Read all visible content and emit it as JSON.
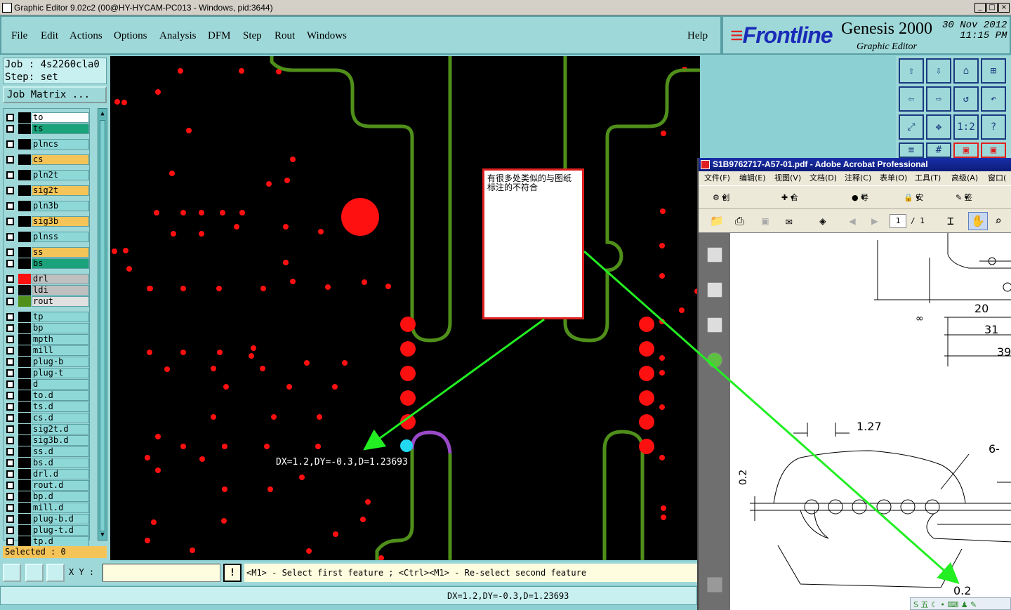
{
  "window": {
    "title": "Graphic Editor 9.02c2 (00@HY-HYCAM-PC013 - Windows, pid:3644)",
    "buttons": [
      "_",
      "□",
      "×"
    ]
  },
  "menu": {
    "items": [
      "File",
      "Edit",
      "Actions",
      "Options",
      "Analysis",
      "DFM",
      "Step",
      "Rout",
      "Windows"
    ],
    "help": "Help"
  },
  "brand": {
    "logo": "Frontline",
    "product": "Genesis 2000",
    "subtitle": "Graphic Editor",
    "date": "30 Nov 2012",
    "time": "11:15 PM"
  },
  "job": {
    "job_line": "Job : 4s2260cla0",
    "step_line": "Step: set",
    "matrix_button": "Job Matrix ..."
  },
  "layers": [
    {
      "name": "to",
      "color": "#ffffff"
    },
    {
      "name": "ts",
      "color": "#1aa37a"
    },
    {
      "name": "plncs",
      "color": "#8fd8d8"
    },
    {
      "name": "cs",
      "color": "#f5c458"
    },
    {
      "name": "pln2t",
      "color": "#8fd8d8"
    },
    {
      "name": "sig2t",
      "color": "#f5c458"
    },
    {
      "name": "pln3b",
      "color": "#8fd8d8"
    },
    {
      "name": "sig3b",
      "color": "#f5c458"
    },
    {
      "name": "plnss",
      "color": "#8fd8d8"
    },
    {
      "name": "ss",
      "color": "#f5c458"
    },
    {
      "name": "bs",
      "color": "#1aa37a"
    },
    {
      "name": "drl",
      "color": "#c0c0c0"
    },
    {
      "name": "ldi",
      "color": "#c0c0c0"
    },
    {
      "name": "rout",
      "color": "#e0e0e0"
    },
    {
      "name": "tp",
      "color": "#8fd8d8"
    },
    {
      "name": "bp",
      "color": "#8fd8d8"
    },
    {
      "name": "mpth",
      "color": "#8fd8d8"
    },
    {
      "name": "mill",
      "color": "#8fd8d8"
    },
    {
      "name": "plug-b",
      "color": "#8fd8d8"
    },
    {
      "name": "plug-t",
      "color": "#8fd8d8"
    },
    {
      "name": "d",
      "color": "#8fd8d8"
    },
    {
      "name": "to.d",
      "color": "#8fd8d8"
    },
    {
      "name": "ts.d",
      "color": "#8fd8d8"
    },
    {
      "name": "cs.d",
      "color": "#8fd8d8"
    },
    {
      "name": "sig2t.d",
      "color": "#8fd8d8"
    },
    {
      "name": "sig3b.d",
      "color": "#8fd8d8"
    },
    {
      "name": "ss.d",
      "color": "#8fd8d8"
    },
    {
      "name": "bs.d",
      "color": "#8fd8d8"
    },
    {
      "name": "drl.d",
      "color": "#8fd8d8"
    },
    {
      "name": "rout.d",
      "color": "#8fd8d8"
    },
    {
      "name": "bp.d",
      "color": "#8fd8d8"
    },
    {
      "name": "mill.d",
      "color": "#8fd8d8"
    },
    {
      "name": "plug-b.d",
      "color": "#8fd8d8"
    },
    {
      "name": "plug-t.d",
      "color": "#8fd8d8"
    },
    {
      "name": "tp.d",
      "color": "#8fd8d8"
    }
  ],
  "selected": "Selected : 0",
  "xy_label": "X Y :",
  "prompt": "<M1> - Select first feature ; <Ctrl><M1> - Re-select second feature",
  "status": "DX=1.2,DY=-0.3,D=1.23693",
  "measure_label": "DX=1.2,DY=-0.3,D=1.23693",
  "note": "有很多处类似的与图纸标注的不符合",
  "toolbar_icons": [
    "1:2",
    "?"
  ],
  "acrobat": {
    "title": "S1B9762717-A57-01.pdf - Adobe Acrobat Professional",
    "menu": [
      "文件(F)",
      "编辑(E)",
      "视图(V)",
      "文档(D)",
      "注释(C)",
      "表单(O)",
      "工具(T)",
      "高级(A)",
      "窗口("
    ],
    "toolbar": [
      "创建 PDF",
      "合并文件",
      "导出",
      "安全",
      "签名"
    ],
    "page_current": "1",
    "page_total": "/ 1",
    "dims": [
      "20",
      "31",
      "39",
      "1.27",
      "6-",
      "0.2",
      "0.2",
      "∞"
    ]
  },
  "colors": {
    "pad_red": "#ff1010",
    "rout_green": "#4f8f1a",
    "arrow_green": "#22ee22",
    "panel": "#9fd8d8"
  }
}
